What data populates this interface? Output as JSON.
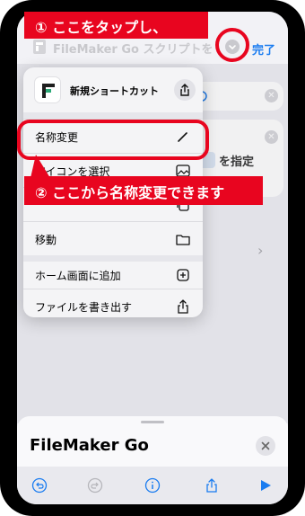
{
  "topbar": {
    "title": "FileMaker Go スクリプトを",
    "done_label": "完了"
  },
  "background": {
    "set_text": "を指定"
  },
  "menu": {
    "shortcut_name": "新規ショートカット",
    "items": [
      {
        "label": "名称変更",
        "icon": "pencil-icon"
      },
      {
        "label": "アイコンを選択",
        "icon": "photo-icon"
      },
      {
        "label": "",
        "icon": "copy-icon"
      },
      {
        "label": "移動",
        "icon": "folder-icon"
      },
      {
        "label": "ホーム画面に追加",
        "icon": "plus-square-icon"
      },
      {
        "label": "ファイルを書き出す",
        "icon": "share-icon"
      }
    ]
  },
  "sheet": {
    "title": "FileMaker Go"
  },
  "annotations": {
    "step1": "① ここをタップし、",
    "step2": "② ここから名称変更できます"
  },
  "colors": {
    "annotation_red": "#e8051f",
    "accent_blue": "#1a7cf0"
  }
}
